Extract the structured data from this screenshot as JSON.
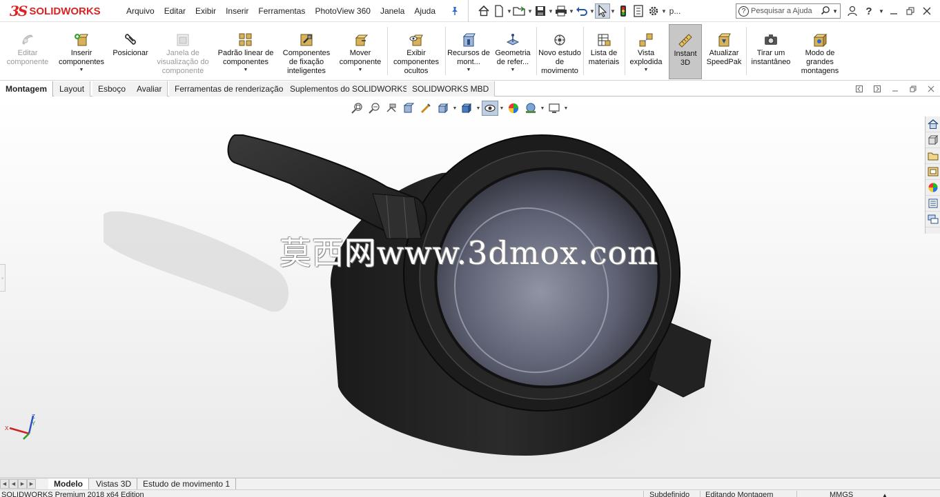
{
  "app": {
    "logo_ds": "3S",
    "logo_text": "SOLIDWORKS",
    "menu": [
      "Arquivo",
      "Editar",
      "Exibir",
      "Inserir",
      "Ferramentas",
      "PhotoView 360",
      "Janela",
      "Ajuda"
    ],
    "user_short": "p...",
    "search_placeholder": "Pesquisar a Ajuda",
    "help_icon_text": "?"
  },
  "command_manager": {
    "buttons": [
      {
        "label": "Editar componente",
        "icon": "edit-component-icon",
        "enabled": false
      },
      {
        "label": "Inserir componentes",
        "icon": "insert-components-icon",
        "enabled": true,
        "dropdown": true
      },
      {
        "label": "Posicionar",
        "icon": "mate-icon",
        "enabled": true
      },
      {
        "label": "Janela de visualização do componente",
        "icon": "component-preview-icon",
        "enabled": false
      },
      {
        "label": "Padrão linear de componentes",
        "icon": "linear-pattern-icon",
        "enabled": true,
        "dropdown": true
      },
      {
        "label": "Componentes de fixação inteligentes",
        "icon": "smart-fasteners-icon",
        "enabled": true
      },
      {
        "label": "Mover componente",
        "icon": "move-component-icon",
        "enabled": true,
        "dropdown": true
      },
      {
        "label": "Exibir componentes ocultos",
        "icon": "show-hidden-icon",
        "enabled": true
      },
      {
        "label": "Recursos de mont...",
        "icon": "assembly-features-icon",
        "enabled": true,
        "dropdown": true
      },
      {
        "label": "Geometria de refer...",
        "icon": "reference-geometry-icon",
        "enabled": true,
        "dropdown": true
      },
      {
        "label": "Novo estudo de movimento",
        "icon": "new-motion-study-icon",
        "enabled": true
      },
      {
        "label": "Lista de materiais",
        "icon": "bill-of-materials-icon",
        "enabled": true
      },
      {
        "label": "Vista explodida",
        "icon": "exploded-view-icon",
        "enabled": true,
        "dropdown": true
      },
      {
        "label": "Instant 3D",
        "icon": "instant3d-icon",
        "enabled": true,
        "active": true
      },
      {
        "label": "Atualizar SpeedPak",
        "icon": "speedpak-icon",
        "enabled": true
      },
      {
        "label": "Tirar um instantâneo",
        "icon": "snapshot-icon",
        "enabled": true
      },
      {
        "label": "Modo de grandes montagens",
        "icon": "large-assembly-icon",
        "enabled": true
      }
    ]
  },
  "tabs": [
    "Montagem",
    "Layout",
    "Esboço",
    "Avaliar",
    "Ferramentas de renderização",
    "Suplementos do SOLIDWORKS",
    "SOLIDWORKS MBD"
  ],
  "active_tab": "Montagem",
  "viewport": {
    "watermark": "莫西网www.3dmox.com",
    "triad": {
      "x": "X",
      "y": "Y",
      "z": "Z"
    }
  },
  "bottom_tabs": [
    "Modelo",
    "Vistas 3D",
    "Estudo de movimento 1"
  ],
  "status": {
    "edition": "SOLIDWORKS Premium 2018 x64 Edition",
    "state": "Subdefinido",
    "mode": "Editando Montagem",
    "units": "MMGS"
  },
  "colors": {
    "brand_red": "#d22222",
    "active_button_bg": "#c7c7c7",
    "viewport_bottom": "#e9e9e9"
  }
}
